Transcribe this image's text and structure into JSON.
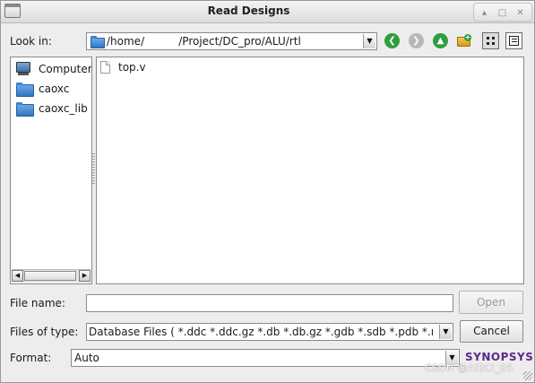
{
  "window": {
    "title": "Read Designs",
    "controls": [
      "▴",
      "□",
      "✕"
    ]
  },
  "look_in": {
    "label": "Look in:",
    "path": "/home/          /Project/DC_pro/ALU/rtl"
  },
  "toolbar": {
    "icons": [
      "back-icon",
      "forward-icon",
      "up-icon",
      "new-folder-icon",
      "list-view-icon",
      "detail-view-icon"
    ],
    "colors": {
      "nav_green": "#2f9e3f",
      "nav_disabled": "#b8b8b8"
    }
  },
  "sidebar": {
    "items": [
      {
        "label": "Computer",
        "icon": "computer-icon"
      },
      {
        "label": "caoxc",
        "icon": "folder-icon"
      },
      {
        "label": "caoxc_lib",
        "icon": "folder-icon"
      }
    ]
  },
  "files": [
    {
      "name": "top.v",
      "icon": "file-icon"
    }
  ],
  "file_name": {
    "label": "File name:",
    "value": ""
  },
  "files_of_type": {
    "label": "Files of type:",
    "value": "Database Files ( *.ddc *.ddc.gz *.db *.db.gz *.gdb *.sdb *.pdb *.ı"
  },
  "format": {
    "label": "Format:",
    "value": "Auto"
  },
  "buttons": {
    "open": "Open",
    "cancel": "Cancel"
  },
  "logo_text": "SYNOPSYS",
  "watermark": "CSDN @AIBCI_05"
}
